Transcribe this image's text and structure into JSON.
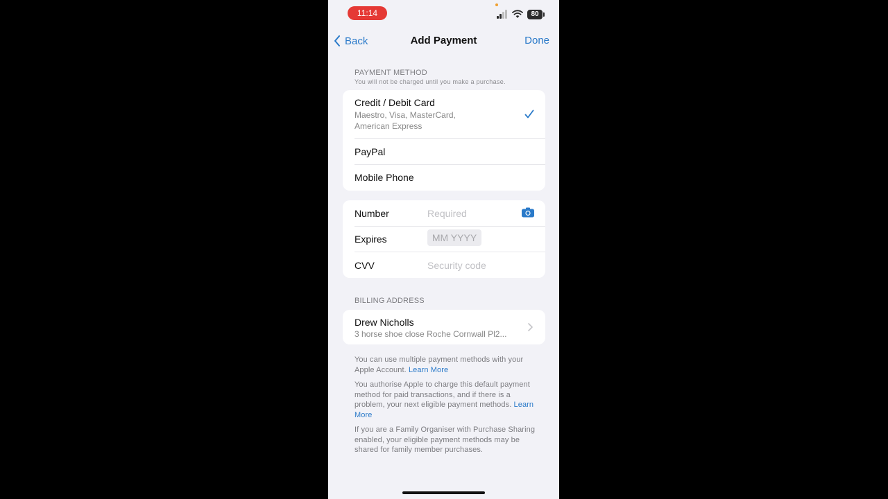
{
  "status_bar": {
    "time": "11:14",
    "battery": "80"
  },
  "nav": {
    "back_label": "Back",
    "title": "Add Payment",
    "done_label": "Done"
  },
  "payment_method": {
    "header": "PAYMENT METHOD",
    "subheader": "You will not be charged until you make a purchase.",
    "options": [
      {
        "label": "Credit / Debit Card",
        "detail_line1": "Maestro, Visa, MasterCard,",
        "detail_line2": "American Express",
        "selected": true
      },
      {
        "label": "PayPal",
        "selected": false
      },
      {
        "label": "Mobile Phone",
        "selected": false
      }
    ]
  },
  "card_fields": {
    "number": {
      "label": "Number",
      "placeholder": "Required"
    },
    "expires": {
      "label": "Expires",
      "placeholder": "MM YYYY"
    },
    "cvv": {
      "label": "CVV",
      "placeholder": "Security code"
    }
  },
  "billing": {
    "header": "BILLING ADDRESS",
    "name": "Drew Nicholls",
    "address": "3 horse shoe close Roche Cornwall Pl2..."
  },
  "footer": {
    "p1_text": "You can use multiple payment methods with your Apple Account.",
    "p1_link": "Learn More",
    "p2_text": "You authorise Apple to charge this default payment method for paid transactions, and if there is a problem, your next eligible payment methods.",
    "p2_link": "Learn More",
    "p3_text": "If you are a Family Organiser with Purchase Sharing enabled, your eligible payment methods may be shared for family member purchases."
  },
  "colors": {
    "accent": "#2a7ac9",
    "recording_badge": "#e53935",
    "background": "#f2f2f7"
  }
}
